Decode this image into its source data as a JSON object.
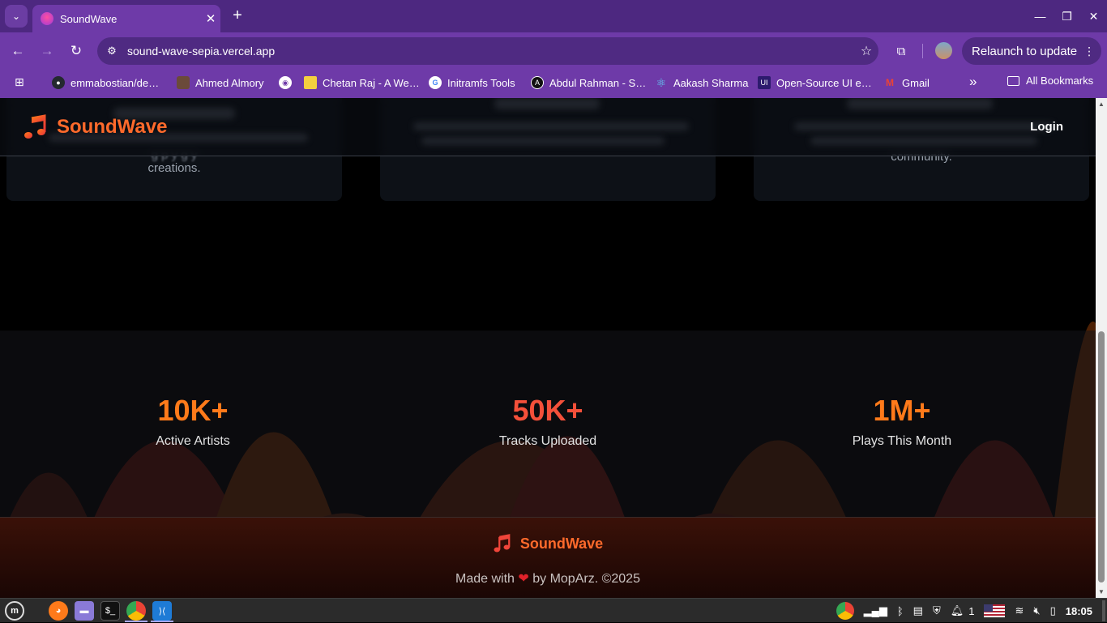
{
  "browser": {
    "tab_title": "SoundWave",
    "url": "sound-wave-sepia.vercel.app",
    "relaunch_label": "Relaunch to update",
    "bookmarks": [
      {
        "label": "emmabostian/de…",
        "color": "#24292f"
      },
      {
        "label": "Ahmed Almory",
        "color": "#6b4a3a"
      },
      {
        "label": "",
        "color": "#3b6bd6"
      },
      {
        "label": "Chetan Raj - A We…",
        "color": "#f4d03f"
      },
      {
        "label": "Initramfs Tools",
        "color": "#ffffff"
      },
      {
        "label": "Abdul Rahman - S…",
        "color": "#111111"
      },
      {
        "label": "Aakash Sharma",
        "color": "#61dafb"
      },
      {
        "label": "Open-Source UI e…",
        "color": "#2d1b6e"
      },
      {
        "label": "Gmail",
        "color": "#ea4335"
      }
    ],
    "all_bookmarks_label": "All Bookmarks"
  },
  "site": {
    "brand": "SoundWave",
    "login_label": "Login",
    "card1_text": "creations.",
    "card3_text": "community.",
    "stats": [
      {
        "value": "10K+",
        "label": "Active Artists",
        "color": "#ff7a1a"
      },
      {
        "value": "50K+",
        "label": "Tracks Uploaded",
        "color": "#f4503a"
      },
      {
        "value": "1M+",
        "label": "Plays This Month",
        "color": "#ff7a1a"
      }
    ],
    "footer_brand": "SoundWave",
    "footer_credit_pre": "Made with",
    "footer_heart": "❤",
    "footer_credit_post": "by MopArz. ©2025"
  },
  "taskbar": {
    "workspace_count": "1",
    "clock": "18:05"
  },
  "colors": {
    "brand_orange": "#ff6a2b",
    "brand_red": "#e8333a",
    "chrome_purple": "#6e3aa8"
  }
}
